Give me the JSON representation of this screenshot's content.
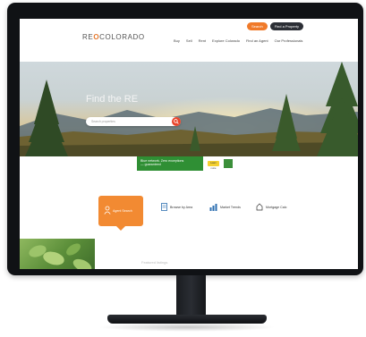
{
  "header": {
    "logo_prefix": "RE",
    "logo_mark": "O",
    "logo_suffix": "COLORADO",
    "top_buttons": [
      "Search",
      "Find a Property"
    ],
    "nav": [
      "Buy",
      "Sell",
      "Rent",
      "Explore Colorado",
      "Find an Agent",
      "Our Professionals"
    ]
  },
  "hero": {
    "title": "Find the RE",
    "search_placeholder": "Search properties"
  },
  "banner": {
    "line1": "Blue network. Zero exceptions",
    "line2": "— guaranteed",
    "button": "Learn more"
  },
  "tabs": [
    {
      "label": "Agent Search",
      "icon": "agent-icon",
      "active": true
    },
    {
      "label": "Browse by Area",
      "icon": "browse-icon",
      "active": false
    },
    {
      "label": "Market Trends",
      "icon": "chart-icon",
      "active": false
    },
    {
      "label": "Mortgage Calc",
      "icon": "mortgage-icon",
      "active": false
    }
  ],
  "below": {
    "text": "Featured listings"
  },
  "colors": {
    "accent": "#f28a32",
    "search_button": "#e8442a",
    "banner": "#2f8f34",
    "monitor": "#101215"
  }
}
